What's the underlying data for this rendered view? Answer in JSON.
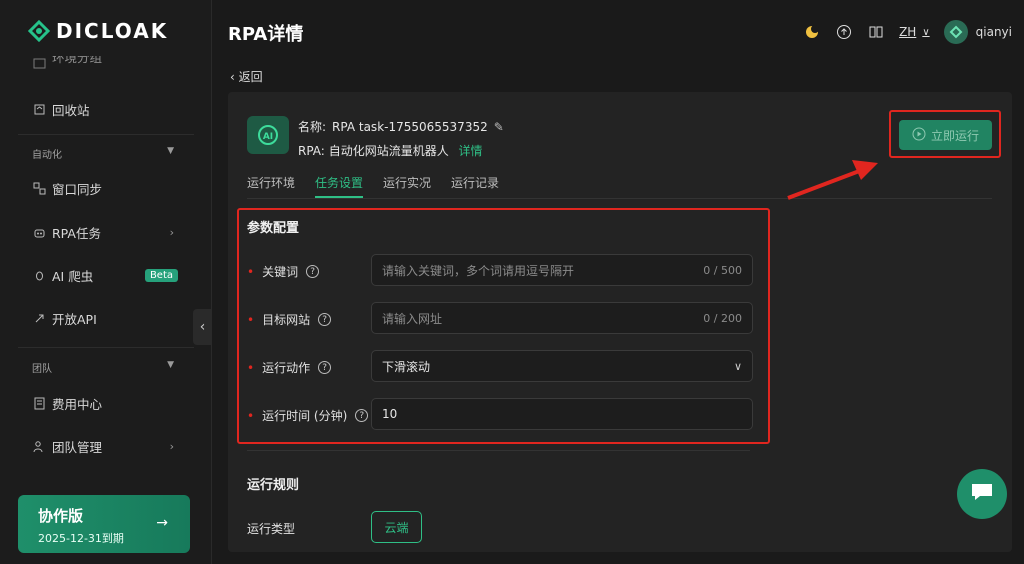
{
  "brand": {
    "name": "DICLOAK"
  },
  "sidebar": {
    "top_partial": "环境分组",
    "recycle": "回收站",
    "section_automation": "自动化",
    "window_sync": "窗口同步",
    "rpa_tasks": "RPA任务",
    "ai_crawler": "AI 爬虫",
    "beta_badge": "Beta",
    "open_api": "开放API",
    "section_team": "团队",
    "billing": "费用中心",
    "team_manage": "团队管理",
    "plan": {
      "name": "协作版",
      "expiry": "2025-12-31到期",
      "arrow": "→"
    }
  },
  "header": {
    "title": "RPA详情",
    "lang": "ZH",
    "username": "qianyi"
  },
  "back_label": "返回",
  "task": {
    "name_label": "名称:",
    "name_value": "RPA task-1755065537352",
    "rpa_label": "RPA:",
    "rpa_value": "自动化网站流量机器人",
    "detail_link": "详情",
    "run_button": "立即运行",
    "logo_text": "AI"
  },
  "tabs": [
    {
      "label": "运行环境"
    },
    {
      "label": "任务设置"
    },
    {
      "label": "运行实况"
    },
    {
      "label": "运行记录"
    }
  ],
  "params": {
    "title": "参数配置",
    "keyword": {
      "label": "关键词",
      "placeholder": "请输入关键词，多个词请用逗号隔开",
      "count": "0 / 500"
    },
    "target": {
      "label": "目标网站",
      "placeholder": "请输入网址",
      "count": "0 / 200"
    },
    "action": {
      "label": "运行动作",
      "value": "下滑滚动"
    },
    "duration": {
      "label": "运行时间 (分钟)",
      "value": "10"
    }
  },
  "rules": {
    "title": "运行规则",
    "type_label": "运行类型",
    "type_value": "云端"
  },
  "colors": {
    "accent": "#2fbf86",
    "highlight": "#e0261f",
    "panel": "#232323"
  }
}
